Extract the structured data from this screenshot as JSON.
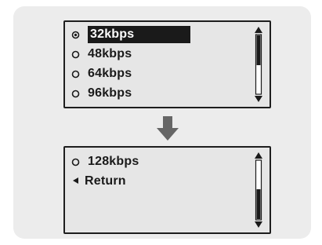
{
  "menu_page_1": {
    "items": [
      {
        "label": "32kbps",
        "selected": true
      },
      {
        "label": "48kbps",
        "selected": false
      },
      {
        "label": "64kbps",
        "selected": false
      },
      {
        "label": "96kbps",
        "selected": false
      }
    ]
  },
  "menu_page_2": {
    "items": [
      {
        "label": "128kbps"
      },
      {
        "label": "Return"
      }
    ]
  },
  "icons": {
    "radio": "radio-empty-icon",
    "radio_selected": "radio-selected-icon",
    "back": "back-arrow-icon",
    "transition": "down-arrow-icon"
  },
  "colors": {
    "panel_bg": "#ececec",
    "screen_bg": "#e6e6e6",
    "selection_bg": "#1a1a1a",
    "text": "#1a1a1a"
  }
}
